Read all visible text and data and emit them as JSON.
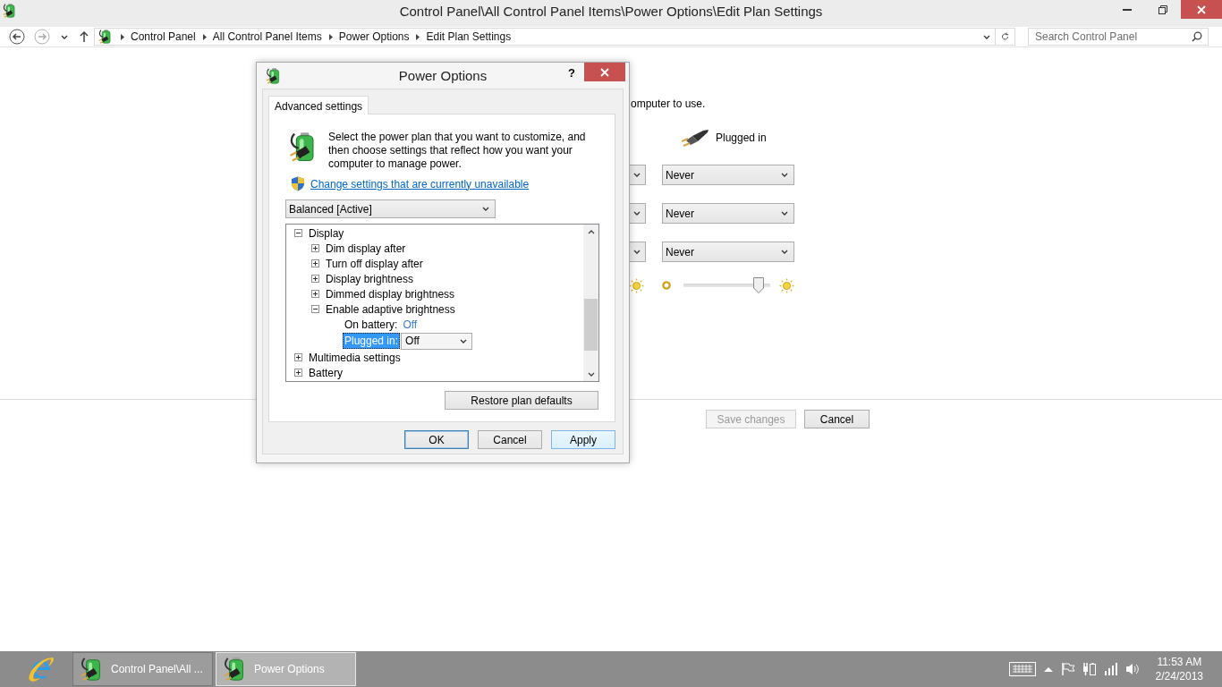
{
  "window": {
    "title": "Control Panel\\All Control Panel Items\\Power Options\\Edit Plan Settings"
  },
  "navigation": {
    "back": {
      "disabled": false
    },
    "forward": {
      "disabled": true
    }
  },
  "address_bar": {
    "breadcrumbs": [
      "Control Panel",
      "All Control Panel Items",
      "Power Options",
      "Edit Plan Settings"
    ],
    "search": {
      "placeholder": "Search Control Panel"
    }
  },
  "plan_settings": {
    "intro_fragment": "omputer to use.",
    "column_header": "Plugged in",
    "rows": [
      {
        "kind": "dropdown",
        "value": "Never"
      },
      {
        "kind": "dropdown",
        "value": "Never"
      },
      {
        "kind": "dropdown",
        "value": "Never"
      },
      {
        "kind": "slider",
        "level": 0.87
      }
    ],
    "buttons": [
      {
        "label": "Save changes",
        "disabled": true
      },
      {
        "label": "Cancel",
        "disabled": false
      }
    ]
  },
  "dialog": {
    "title": "Power Options",
    "help": "?",
    "tabs": [
      {
        "label": "Advanced settings",
        "selected": true
      }
    ],
    "description": "Select the power plan that you want to customize, and then choose settings that reflect how you want your computer to manage power.",
    "link": "Change settings that are currently unavailable",
    "plan": {
      "value": "Balanced [Active]"
    },
    "tree": [
      {
        "label": "Display",
        "expanded": true,
        "children": [
          {
            "label": "Dim display after",
            "expanded": false
          },
          {
            "label": "Turn off display after",
            "expanded": false
          },
          {
            "label": "Display brightness",
            "expanded": false
          },
          {
            "label": "Dimmed display brightness",
            "expanded": false
          },
          {
            "label": "Enable adaptive brightness",
            "expanded": true,
            "children": [
              {
                "kind": "value",
                "label": "On battery:",
                "value": "Off",
                "selected": false
              },
              {
                "kind": "dropdown",
                "label": "Plugged in:",
                "value": "Off",
                "selected": true
              }
            ]
          }
        ]
      },
      {
        "label": "Multimedia settings",
        "expanded": false
      },
      {
        "label": "Battery",
        "expanded": false
      }
    ],
    "restore_button": "Restore plan defaults",
    "buttons": [
      {
        "label": "OK",
        "default": true,
        "hot": false
      },
      {
        "label": "Cancel",
        "default": false,
        "hot": false
      },
      {
        "label": "Apply",
        "default": false,
        "hot": true
      }
    ]
  },
  "taskbar": {
    "tasks": [
      {
        "label": "Control Panel\\All ...",
        "selected": false
      },
      {
        "label": "Power Options",
        "selected": true
      }
    ],
    "clock": {
      "time": "11:53 AM",
      "date": "2/24/2013"
    }
  }
}
